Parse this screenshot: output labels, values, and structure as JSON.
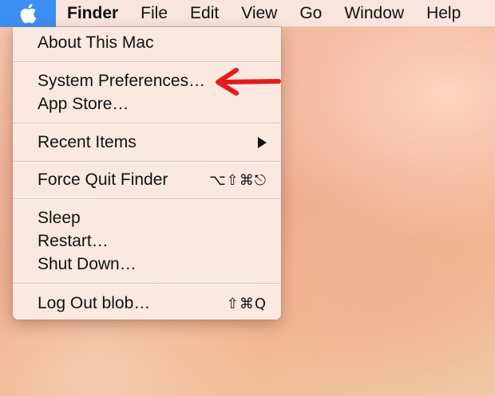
{
  "menubar": {
    "items": [
      {
        "label": "Finder"
      },
      {
        "label": "File"
      },
      {
        "label": "Edit"
      },
      {
        "label": "View"
      },
      {
        "label": "Go"
      },
      {
        "label": "Window"
      },
      {
        "label": "Help"
      }
    ]
  },
  "apple_menu": {
    "about": "About This Mac",
    "system_prefs": "System Preferences…",
    "app_store": "App Store…",
    "recent_items": "Recent Items",
    "force_quit": "Force Quit Finder",
    "force_quit_shortcut": "⌥⇧⌘⎋",
    "sleep": "Sleep",
    "restart": "Restart…",
    "shut_down": "Shut Down…",
    "log_out": "Log Out blob…",
    "log_out_shortcut": "⇧⌘Q"
  },
  "colors": {
    "apple_highlight": "#3d8ef2",
    "annotation_arrow": "#e41b1b"
  }
}
